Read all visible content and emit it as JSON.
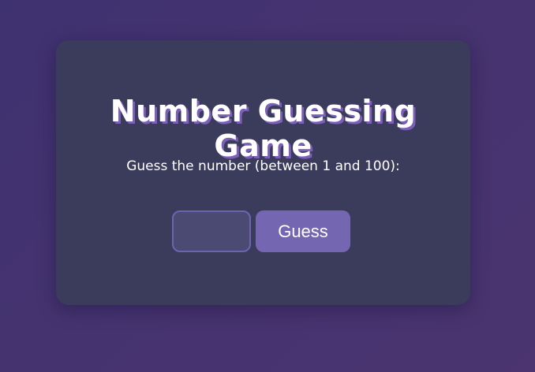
{
  "game": {
    "title": "Number Guessing Game",
    "instructions": "Guess the number (between 1 and 100):",
    "input": {
      "value": "",
      "placeholder": ""
    },
    "guess_button_label": "Guess"
  },
  "colors": {
    "background": "#44336f",
    "card": "#3b3b5c",
    "title_shadow": "#7c5fb8",
    "input_bg": "#4b4a72",
    "input_border": "#6e63b0",
    "button": "#7466b0",
    "text": "#ffffff"
  }
}
